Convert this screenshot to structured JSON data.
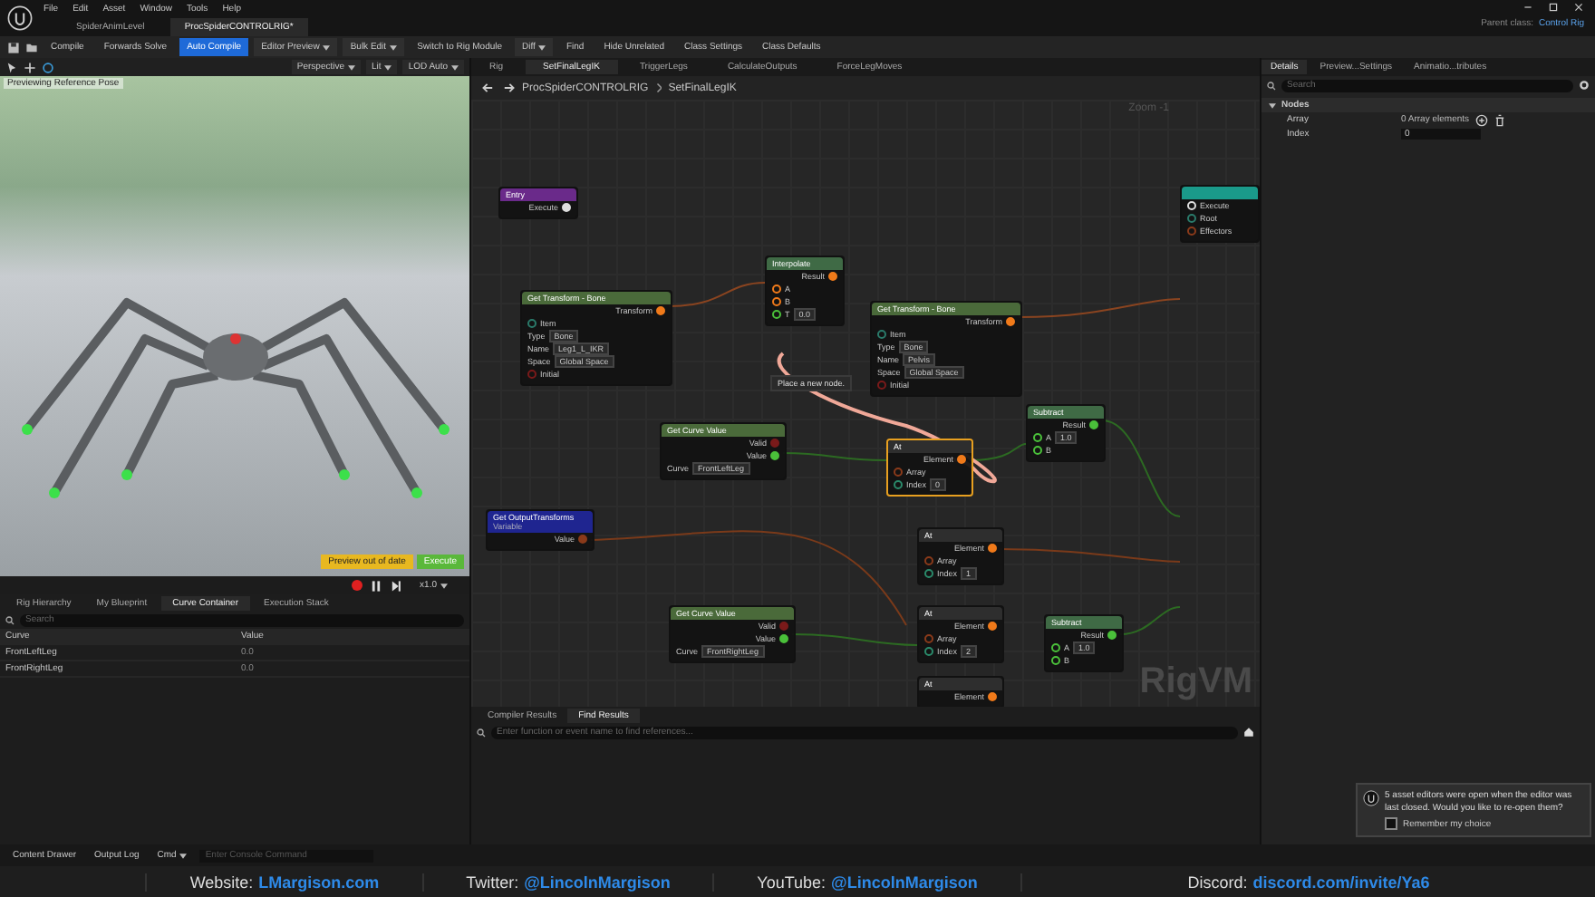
{
  "menu": [
    "File",
    "Edit",
    "Asset",
    "Window",
    "Tools",
    "Help"
  ],
  "document_tabs": [
    {
      "label": "SpiderAnimLevel",
      "selected": false
    },
    {
      "label": "ProcSpiderCONTROLRIG*",
      "selected": true
    }
  ],
  "parent_class": {
    "label": "Parent class:",
    "value": "Control Rig"
  },
  "toolbar": [
    {
      "label": "Compile",
      "kind": "button"
    },
    {
      "label": "Forwards Solve",
      "kind": "button"
    },
    {
      "label": "Auto Compile",
      "kind": "active"
    },
    {
      "label": "Editor Preview",
      "kind": "dropdown"
    },
    {
      "label": "Bulk Edit",
      "kind": "dropdown"
    },
    {
      "label": "Switch to Rig Module",
      "kind": "button"
    },
    {
      "label": "Diff",
      "kind": "dropdown"
    },
    {
      "label": "Find",
      "kind": "button"
    },
    {
      "label": "Hide Unrelated",
      "kind": "button"
    },
    {
      "label": "Class Settings",
      "kind": "button"
    },
    {
      "label": "Class Defaults",
      "kind": "button"
    }
  ],
  "viewport": {
    "toolbar": [
      "Perspective",
      "Lit",
      "LOD Auto"
    ],
    "caption": "Previewing Reference Pose",
    "warning": "Preview out of date",
    "execute": "Execute",
    "speed": "x1.0"
  },
  "left_panel": {
    "tabs": [
      {
        "label": "Rig Hierarchy",
        "selected": false
      },
      {
        "label": "My Blueprint",
        "selected": false
      },
      {
        "label": "Curve Container",
        "selected": true
      },
      {
        "label": "Execution Stack",
        "selected": false
      }
    ],
    "search": {
      "placeholder": "Search"
    },
    "columns": [
      "Curve",
      "Value"
    ],
    "rows": [
      [
        "FrontLeftLeg",
        "0.0"
      ],
      [
        "FrontRightLeg",
        "0.0"
      ]
    ]
  },
  "graph": {
    "tabs": [
      {
        "label": "Rig",
        "selected": false
      },
      {
        "label": "SetFinalLegIK",
        "selected": true
      },
      {
        "label": "TriggerLegs",
        "selected": false
      },
      {
        "label": "CalculateOutputs",
        "selected": false
      },
      {
        "label": "ForceLegMoves",
        "selected": false
      }
    ],
    "breadcrumb": [
      "ProcSpiderCONTROLRIG",
      "SetFinalLegIK"
    ],
    "zoom": "Zoom -1",
    "watermark": "RigVM",
    "tooltip": "Place a new node.",
    "nodes": [
      {
        "title": "Entry",
        "kind": "entry",
        "selected": false,
        "rows": [
          {
            "label": "Execute",
            "kind": "out",
            "color": "#dddddd"
          }
        ]
      },
      {
        "title": "Get Transform - Bone",
        "kind": "function",
        "selected": false,
        "rows": [
          {
            "label": "Transform",
            "kind": "out",
            "color": "#f07a1a"
          },
          {
            "label": "Item",
            "kind": "in",
            "color": "#2a7a6a"
          },
          {
            "label": "Type",
            "kind": "in",
            "value": "Bone"
          },
          {
            "label": "Name",
            "kind": "in",
            "value": "Leg1_L_IKR"
          },
          {
            "label": "Space",
            "kind": "in",
            "value": "Global Space"
          },
          {
            "label": "Initial",
            "kind": "in",
            "color": "#7a1a1a"
          }
        ]
      },
      {
        "title": "Interpolate",
        "kind": "math",
        "selected": false,
        "rows": [
          {
            "label": "Result",
            "kind": "out",
            "color": "#f07a1a"
          },
          {
            "label": "A",
            "kind": "in",
            "color": "#f07a1a"
          },
          {
            "label": "B",
            "kind": "in",
            "color": "#f07a1a"
          },
          {
            "label": "T",
            "kind": "in",
            "color": "#4ac03a",
            "value": "0.0"
          }
        ]
      },
      {
        "title": "Get Transform - Bone",
        "kind": "function",
        "selected": false,
        "rows": [
          {
            "label": "Transform",
            "kind": "out",
            "color": "#f07a1a"
          },
          {
            "label": "Item",
            "kind": "in",
            "color": "#2a7a6a"
          },
          {
            "label": "Type",
            "kind": "in",
            "value": "Bone"
          },
          {
            "label": "Name",
            "kind": "in",
            "value": "Pelvis"
          },
          {
            "label": "Space",
            "kind": "in",
            "value": "Global Space"
          },
          {
            "label": "Initial",
            "kind": "in",
            "color": "#7a1a1a"
          }
        ]
      },
      {
        "title": "Get Curve Value",
        "kind": "function",
        "selected": false,
        "rows": [
          {
            "label": "Valid",
            "kind": "out",
            "color": "#7a1a1a"
          },
          {
            "label": "Value",
            "kind": "out",
            "color": "#4ac03a"
          },
          {
            "label": "Curve",
            "kind": "in",
            "value": "FrontLeftLeg"
          }
        ]
      },
      {
        "title": "At",
        "kind": "array",
        "selected": true,
        "rows": [
          {
            "label": "Element",
            "kind": "out",
            "color": "#f07a1a"
          },
          {
            "label": "Array",
            "kind": "in",
            "color": "#8a3a1a"
          },
          {
            "label": "Index",
            "kind": "in",
            "color": "#2a8a6a",
            "value": "0"
          }
        ]
      },
      {
        "title": "Subtract",
        "kind": "math",
        "selected": false,
        "rows": [
          {
            "label": "Result",
            "kind": "out",
            "color": "#4ac03a"
          },
          {
            "label": "A",
            "kind": "in",
            "color": "#4ac03a",
            "value": "1.0"
          },
          {
            "label": "B",
            "kind": "in",
            "color": "#4ac03a"
          }
        ]
      },
      {
        "title": "Get OutputTransforms",
        "subtitle": "Variable",
        "kind": "variable",
        "selected": false,
        "rows": [
          {
            "label": "Value",
            "kind": "out",
            "color": "#8a3a1a"
          }
        ]
      },
      {
        "title": "At",
        "kind": "array",
        "selected": false,
        "rows": [
          {
            "label": "Element",
            "kind": "out",
            "color": "#f07a1a"
          },
          {
            "label": "Array",
            "kind": "in",
            "color": "#8a3a1a"
          },
          {
            "label": "Index",
            "kind": "in",
            "color": "#2a8a6a",
            "value": "1"
          }
        ]
      },
      {
        "title": "Get Curve Value",
        "kind": "function",
        "selected": false,
        "rows": [
          {
            "label": "Valid",
            "kind": "out",
            "color": "#7a1a1a"
          },
          {
            "label": "Value",
            "kind": "out",
            "color": "#4ac03a"
          },
          {
            "label": "Curve",
            "kind": "in",
            "value": "FrontRightLeg"
          }
        ]
      },
      {
        "title": "At",
        "kind": "array",
        "selected": false,
        "rows": [
          {
            "label": "Element",
            "kind": "out",
            "color": "#f07a1a"
          },
          {
            "label": "Array",
            "kind": "in",
            "color": "#8a3a1a"
          },
          {
            "label": "Index",
            "kind": "in",
            "color": "#2a8a6a",
            "value": "2"
          }
        ]
      },
      {
        "title": "Subtract",
        "kind": "math",
        "selected": false,
        "rows": [
          {
            "label": "Result",
            "kind": "out",
            "color": "#4ac03a"
          },
          {
            "label": "A",
            "kind": "in",
            "color": "#4ac03a",
            "value": "1.0"
          },
          {
            "label": "B",
            "kind": "in",
            "color": "#4ac03a"
          }
        ]
      },
      {
        "title": "At",
        "kind": "array",
        "selected": false,
        "rows": [
          {
            "label": "Element",
            "kind": "out",
            "color": "#f07a1a"
          }
        ]
      },
      {
        "kind": "ik",
        "selected": false,
        "rows": [
          {
            "label": "Execute",
            "kind": "in",
            "color": "#dddddd"
          },
          {
            "label": "Root",
            "kind": "in",
            "color": "#2a7a6a"
          },
          {
            "label": "Effectors",
            "kind": "in",
            "color": "#8a3a1a"
          }
        ]
      }
    ]
  },
  "results": {
    "tabs": [
      {
        "label": "Compiler Results",
        "selected": false
      },
      {
        "label": "Find Results",
        "selected": true
      }
    ],
    "search": {
      "placeholder": "Enter function or event name to find references..."
    }
  },
  "details": {
    "tabs": [
      {
        "label": "Details",
        "selected": true
      },
      {
        "label": "Preview...Settings",
        "selected": false
      },
      {
        "label": "Animatio...tributes",
        "selected": false
      }
    ],
    "search": {
      "placeholder": "Search"
    },
    "section": "Nodes",
    "properties": [
      {
        "label": "Array",
        "value": "0 Array elements",
        "kind": "array"
      },
      {
        "label": "Index",
        "value": "0",
        "kind": "field"
      }
    ]
  },
  "notification": {
    "message": "5 asset editors were open when the editor was last closed. Would you like to re-open them?",
    "checkbox": {
      "label": "Remember my choice",
      "checked": false
    }
  },
  "status_bar": {
    "buttons": [
      "Content Drawer",
      "Output Log"
    ],
    "cmd": "Cmd",
    "placeholder": "Enter Console Command"
  },
  "banner": [
    {
      "label": "Website:",
      "link": "LMargison.com"
    },
    {
      "label": "Twitter:",
      "link": "@LincolnMargison"
    },
    {
      "label": "YouTube:",
      "link": "@LincolnMargison"
    },
    {
      "label": "Discord:",
      "link": "discord.com/invite/Ya6"
    }
  ]
}
